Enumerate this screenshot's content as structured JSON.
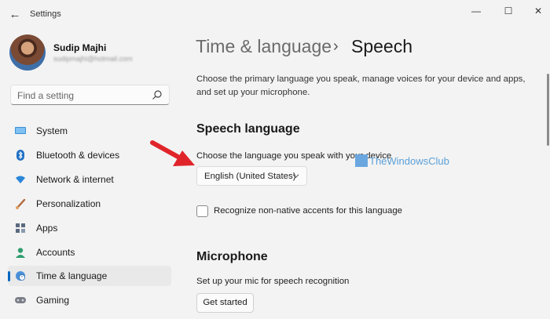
{
  "window": {
    "title": "Settings",
    "back_icon": "←",
    "minimize_icon": "—",
    "maximize_icon": "☐",
    "close_icon": "✕"
  },
  "user": {
    "name": "Sudip Majhi",
    "email": "sudipmajhi@hotmail.com"
  },
  "search": {
    "placeholder": "Find a setting"
  },
  "sidebar": {
    "items": [
      {
        "label": "System",
        "icon": "system-icon"
      },
      {
        "label": "Bluetooth & devices",
        "icon": "bluetooth-icon"
      },
      {
        "label": "Network & internet",
        "icon": "wifi-icon"
      },
      {
        "label": "Personalization",
        "icon": "brush-icon"
      },
      {
        "label": "Apps",
        "icon": "apps-icon"
      },
      {
        "label": "Accounts",
        "icon": "accounts-icon"
      },
      {
        "label": "Time & language",
        "icon": "globe-clock-icon",
        "selected": true
      },
      {
        "label": "Gaming",
        "icon": "gamepad-icon"
      }
    ]
  },
  "breadcrumb": {
    "parent": "Time & language",
    "separator": "›",
    "current": "Speech"
  },
  "intro": "Choose the primary language you speak, manage voices for your device and apps, and set up your microphone.",
  "speech_language": {
    "heading": "Speech language",
    "prompt": "Choose the language you speak with your device",
    "selected": "English (United States)",
    "checkbox_label": "Recognize non-native accents for this language",
    "checkbox_checked": false
  },
  "microphone": {
    "heading": "Microphone",
    "prompt": "Set up your mic for speech recognition",
    "button": "Get started"
  },
  "watermark": {
    "text": "TheWindowsClub"
  },
  "colors": {
    "accent": "#0067c0",
    "arrow": "#e0252a",
    "background": "#f3f3f3"
  }
}
